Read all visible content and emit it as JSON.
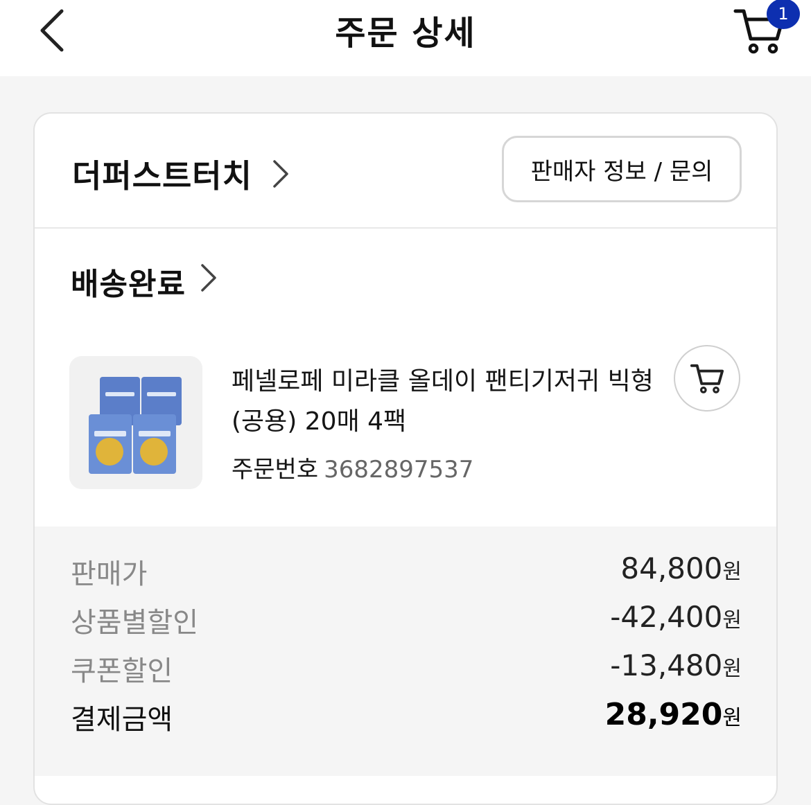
{
  "header": {
    "title": "주문 상세",
    "cart_badge": "1"
  },
  "seller": {
    "name": "더퍼스트터치",
    "info_button": "판매자 정보 / 문의"
  },
  "order": {
    "status": "배송완료",
    "product_name": "페넬로페  미라클 올데이 팬티기저귀 빅형(공용) 20매 4팩",
    "order_no_label": "주문번호",
    "order_no": "3682897537"
  },
  "prices": [
    {
      "label": "판매가",
      "value": "84,800",
      "unit": "원"
    },
    {
      "label": "상품별할인",
      "value": "-42,400",
      "unit": "원"
    },
    {
      "label": "쿠폰할인",
      "value": "-13,480",
      "unit": "원"
    },
    {
      "label": "결제금액",
      "value": "28,920",
      "unit": "원"
    }
  ],
  "colors": {
    "badge": "#0d2fb0",
    "background": "#f5f5f5"
  }
}
